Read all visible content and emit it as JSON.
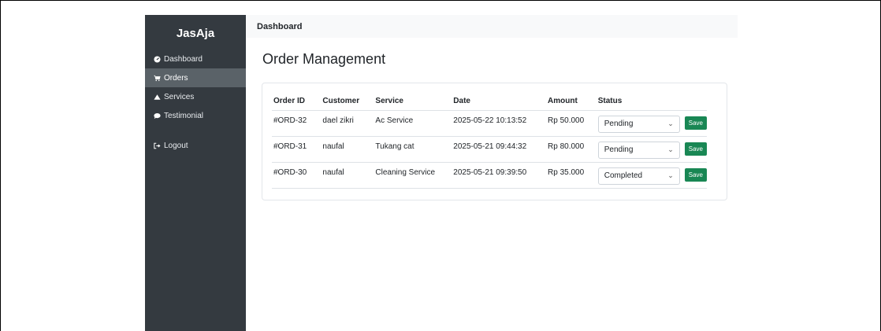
{
  "brand": "JasAja",
  "sidebar": {
    "items": [
      {
        "label": "Dashboard",
        "icon": "dashboard-icon"
      },
      {
        "label": "Orders",
        "icon": "cart-icon",
        "active": true
      },
      {
        "label": "Services",
        "icon": "tent-icon"
      },
      {
        "label": "Testimonial",
        "icon": "comment-icon"
      }
    ],
    "logout": {
      "label": "Logout",
      "icon": "sign-out-icon"
    }
  },
  "topbar": {
    "title": "Dashboard"
  },
  "page": {
    "title": "Order Management"
  },
  "table": {
    "columns": [
      "Order ID",
      "Customer",
      "Service",
      "Date",
      "Amount",
      "Status"
    ],
    "rows": [
      {
        "id": "#ORD-32",
        "customer": "dael zikri",
        "service": "Ac Service",
        "date": "2025-05-22 10:13:52",
        "amount": "Rp 50.000",
        "status": "Pending"
      },
      {
        "id": "#ORD-31",
        "customer": "naufal",
        "service": "Tukang cat",
        "date": "2025-05-21 09:44:32",
        "amount": "Rp 80.000",
        "status": "Pending"
      },
      {
        "id": "#ORD-30",
        "customer": "naufal",
        "service": "Cleaning Service",
        "date": "2025-05-21 09:39:50",
        "amount": "Rp 35.000",
        "status": "Completed"
      }
    ],
    "save_label": "Save"
  },
  "colors": {
    "sidebar_bg": "#343a40",
    "sidebar_active": "#5a6268",
    "save_button": "#198754"
  }
}
